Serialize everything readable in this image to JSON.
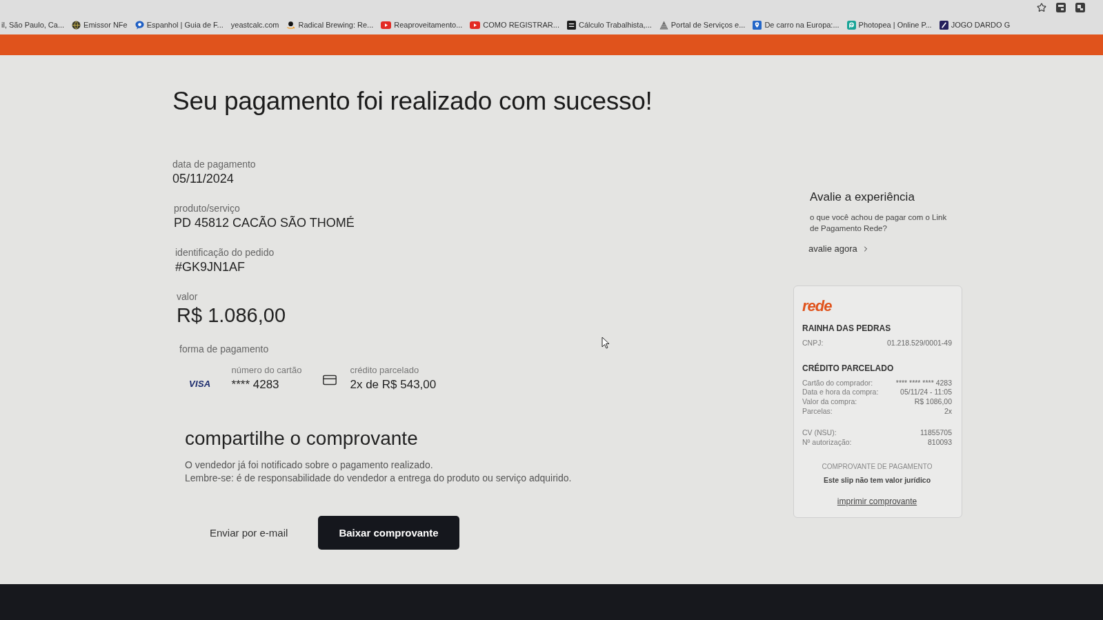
{
  "browser": {
    "bookmarks": [
      {
        "label": "il, São Paulo, Ca..."
      },
      {
        "label": "Emissor NFe"
      },
      {
        "label": "Espanhol | Guia de F..."
      },
      {
        "label": "yeastcalc.com"
      },
      {
        "label": "Radical Brewing: Re..."
      },
      {
        "label": "Reaproveitamento..."
      },
      {
        "label": "COMO REGISTRAR..."
      },
      {
        "label": "Cálculo Trabalhista,..."
      },
      {
        "label": "Portal de Serviços e..."
      },
      {
        "label": "De carro na Europa:..."
      },
      {
        "label": "Photopea | Online P..."
      },
      {
        "label": "JOGO DARDO G"
      }
    ]
  },
  "page": {
    "title": "Seu pagamento foi realizado com sucesso!",
    "details": [
      {
        "label": "data de pagamento",
        "value": "05/11/2024",
        "kind": "text"
      },
      {
        "label": "produto/serviço",
        "value": "PD 45812 CACÃO SÃO THOMÉ",
        "kind": "text"
      },
      {
        "label": "identificação do pedido",
        "value": "#GK9JN1AF",
        "kind": "text"
      },
      {
        "label": "valor",
        "value": "R$ 1.086,00",
        "kind": "amount"
      }
    ],
    "payment_method": {
      "label": "forma de pagamento",
      "card_brand": "VISA",
      "card_number": {
        "label": "número do cartão",
        "value": "**** 4283"
      },
      "installments": {
        "label": "crédito parcelado",
        "value": "2x de R$ 543,00"
      }
    },
    "share": {
      "heading": "compartilhe o comprovante",
      "message": [
        "O vendedor já foi notificado sobre o pagamento realizado.",
        "Lembre-se: é de responsabilidade do vendedor a entrega do produto ou serviço adquirido."
      ],
      "buttons": [
        {
          "label": "Enviar por e-mail",
          "kind": "text"
        },
        {
          "label": "Baixar comprovante",
          "kind": "primary"
        }
      ]
    }
  },
  "feedback": {
    "title": "Avalie a experiência",
    "question": "o que você achou de pagar com o Link de Pagamento Rede?",
    "link": "avalie agora"
  },
  "receipt": {
    "logo": "rede",
    "merchant": "RAINHA DAS PEDRAS",
    "tax_id": {
      "label": "CNPJ:",
      "value": "01.218.529/0001-49"
    },
    "type": "CRÉDITO PARCELADO",
    "rows": [
      {
        "label": "Cartão do comprador:",
        "value": "**** **** **** 4283"
      },
      {
        "label": "Data e hora da compra:",
        "value": "05/11/24 - 11:05"
      },
      {
        "label": "Valor da compra:",
        "value": "R$ 1086,00"
      },
      {
        "label": "Parcelas:",
        "value": "2x"
      }
    ],
    "codes": [
      {
        "label": "CV (NSU):",
        "value": "11855705"
      },
      {
        "label": "Nº autorização:",
        "value": "810093"
      }
    ],
    "footer_title": "COMPROVANTE DE PAGAMENTO",
    "disclaimer": "Este slip não tem valor jurídico",
    "print_link": "imprimir comprovante"
  }
}
